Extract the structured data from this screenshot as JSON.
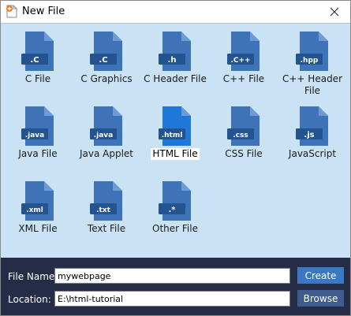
{
  "window": {
    "title": "New File"
  },
  "colors": {
    "icon_dark": "#24548f",
    "icon_main": "#3f73b8",
    "icon_fold": "#6f9ad4",
    "icon_highlight": "#1f78d8",
    "grid_background": "#c9e3f5",
    "bottom_background": "#252c47",
    "create_button": "#3a78c4",
    "browse_button": "#3f5c8e"
  },
  "file_types": [
    {
      "ext": ".C",
      "label": "C File",
      "icon": "c-file-icon"
    },
    {
      "ext": ".C",
      "label": "C Graphics",
      "icon": "c-graphics-icon"
    },
    {
      "ext": ".h",
      "label": "C Header File",
      "icon": "c-header-file-icon"
    },
    {
      "ext": ".C++",
      "label": "C++ File",
      "icon": "cpp-file-icon"
    },
    {
      "ext": ".hpp",
      "label": "C++ Header File",
      "icon": "cpp-header-file-icon"
    },
    {
      "ext": ".java",
      "label": "Java File",
      "icon": "java-file-icon"
    },
    {
      "ext": ".java",
      "label": "Java Applet",
      "icon": "java-applet-icon"
    },
    {
      "ext": ".html",
      "label": "HTML File",
      "icon": "html-file-icon",
      "selected": true
    },
    {
      "ext": ".css",
      "label": "CSS File",
      "icon": "css-file-icon"
    },
    {
      "ext": ".js",
      "label": "JavaScript",
      "icon": "javascript-file-icon"
    },
    {
      "ext": ".xml",
      "label": "XML File",
      "icon": "xml-file-icon"
    },
    {
      "ext": ".txt",
      "label": "Text File",
      "icon": "text-file-icon"
    },
    {
      "ext": ".*",
      "label": "Other File",
      "icon": "other-file-icon"
    }
  ],
  "form": {
    "file_name_label": "File Name:",
    "file_name_value": "mywebpage",
    "location_label": "Location:",
    "location_value": "E:\\html-tutorial",
    "create_label": "Create",
    "browse_label": "Browse"
  }
}
